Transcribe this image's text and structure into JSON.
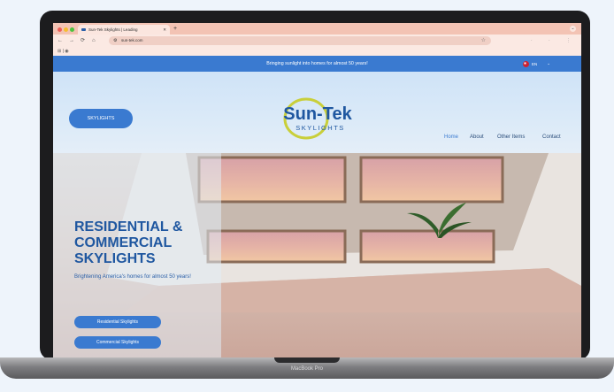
{
  "device": {
    "label": "MacBook Pro"
  },
  "browser": {
    "tab_title": "Sun-Tek Skylights | Leading",
    "tab_close": "✕",
    "new_tab": "+",
    "url": "sun-tek.com",
    "back": "←",
    "forward": "→",
    "reload": "⟳",
    "home": "⌂",
    "bookmarks_text": "⊞ | ◉"
  },
  "site": {
    "announcement": "Bringing sunlight into homes for almost 50 years!",
    "lang": "EN",
    "skylights_button": "SKYLIGHTS",
    "logo": {
      "main": "Sun-Tek",
      "sub": "SKYLIGHTS"
    },
    "nav": [
      "Home",
      "About",
      "Other Items",
      "Contact"
    ],
    "hero": {
      "title_lines": [
        "RESIDENTIAL &",
        "COMMERCIAL",
        "SKYLIGHTS"
      ],
      "subtitle": "Brightening America's homes for almost 50 years!",
      "cta": [
        "Residential Skylights",
        "Commercial Skylights"
      ]
    }
  },
  "colors": {
    "brand_blue": "#3a7ad0",
    "tab_bar": "#f3c3b4",
    "logo_yellow": "#c9cf3a",
    "logo_blue": "#1f57a0"
  }
}
